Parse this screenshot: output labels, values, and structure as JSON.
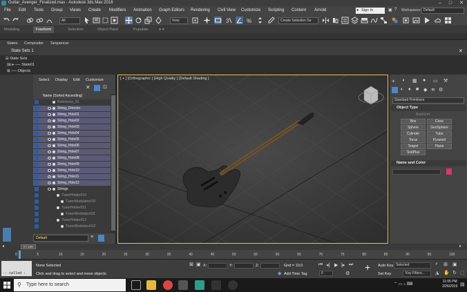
{
  "window": {
    "title": "Guitar_Avenger_Finalized.max - Autodesk 3ds Max 2018"
  },
  "menubar": {
    "items": [
      "File",
      "Edit",
      "Tools",
      "Group",
      "Views",
      "Create",
      "Modifiers",
      "Animation",
      "Graph Editors",
      "Rendering",
      "Civil View",
      "Customize",
      "Scripting",
      "Content",
      "Arnold"
    ],
    "signin": "Sign In",
    "workspace_label": "Workspaces:",
    "workspace_value": "Default"
  },
  "toolbar": {
    "selection_filter": "All",
    "ref_coord": "View",
    "selection_set": "Create Selection Se"
  },
  "ribbon": {
    "tabs": [
      "Modeling",
      "Freeform",
      "Selection",
      "Object Paint",
      "Populate"
    ],
    "active": "Freeform",
    "row3": [
      "States",
      "Compositor",
      "Sequencer"
    ]
  },
  "state_sets": {
    "header": "State Sets 1",
    "items": [
      "State Sets",
      "State01",
      "Objects"
    ]
  },
  "explorer": {
    "menu": [
      "Select",
      "Display",
      "Edit",
      "Customize"
    ],
    "column_header": "Name (Sorted Ascending)",
    "rows": [
      {
        "name": "Reference_S1",
        "faded": true,
        "depth": 1
      },
      {
        "name": "String_Director",
        "faded": false,
        "depth": 1
      },
      {
        "name": "String_Hole01",
        "faded": false,
        "depth": 1
      },
      {
        "name": "String_Hole02",
        "faded": false,
        "depth": 1
      },
      {
        "name": "String_Hole03",
        "faded": false,
        "depth": 1
      },
      {
        "name": "String_Hole04",
        "faded": false,
        "depth": 1
      },
      {
        "name": "String_Hole05",
        "faded": false,
        "depth": 1
      },
      {
        "name": "String_Hole06",
        "faded": false,
        "depth": 1
      },
      {
        "name": "String_Hole07",
        "faded": false,
        "depth": 1
      },
      {
        "name": "String_Hole08",
        "faded": false,
        "depth": 1
      },
      {
        "name": "String_Hole09",
        "faded": false,
        "depth": 1
      },
      {
        "name": "String_Hole10",
        "faded": false,
        "depth": 1
      },
      {
        "name": "String_Hole11",
        "faded": false,
        "depth": 1
      },
      {
        "name": "String_Hole12",
        "faded": false,
        "depth": 1
      },
      {
        "name": "Strings",
        "faded": false,
        "depth": 1
      },
      {
        "name": "TunerHolder010",
        "faded": true,
        "depth": 2
      },
      {
        "name": "TunerModulator010",
        "faded": true,
        "depth": 3
      },
      {
        "name": "TunerHolder011",
        "faded": true,
        "depth": 2
      },
      {
        "name": "TunerModulator011",
        "faded": true,
        "depth": 3
      },
      {
        "name": "TunerHolder012",
        "faded": true,
        "depth": 2
      },
      {
        "name": "TunerModulator012",
        "faded": true,
        "depth": 3
      }
    ],
    "layer": "Default"
  },
  "viewport": {
    "label": "[ + ] [Orthographic ] [High Quality ] [Default Shading ]"
  },
  "command_panel": {
    "dropdown": "Standard Primitives",
    "object_type": "Object Type",
    "autogrid": "AutoGrid",
    "buttons": [
      "Box",
      "Cone",
      "Sphere",
      "GeoSphere",
      "Cylinder",
      "Tube",
      "Torus",
      "Pyramid",
      "Teapot",
      "Plane",
      "TextPlus"
    ],
    "name_color": "Name and Color",
    "swatch_color": "#d4386f"
  },
  "timeline": {
    "slider": "0 / 100",
    "ticks": [
      "0",
      "5",
      "10",
      "15",
      "20",
      "25",
      "30",
      "35",
      "40",
      "45",
      "50",
      "55",
      "60",
      "65",
      "70",
      "75",
      "80",
      "85",
      "90",
      "95",
      "100"
    ]
  },
  "status": {
    "maxscript": "-- called :",
    "selection": "None Selected",
    "prompt": "Click and drag to select and move objects",
    "x_label": "X:",
    "y_label": "Y:",
    "z_label": "Z:",
    "grid": "Grid = 10.0",
    "add_time_tag": "Add Time Tag",
    "auto_key": "Auto Key",
    "set_key": "Set Key",
    "selected": "Selected",
    "key_filters": "Key Filters...",
    "frame": "0"
  },
  "taskbar": {
    "search": "Type here to search",
    "time": "11:05 PM",
    "date": "2/26/2019"
  }
}
